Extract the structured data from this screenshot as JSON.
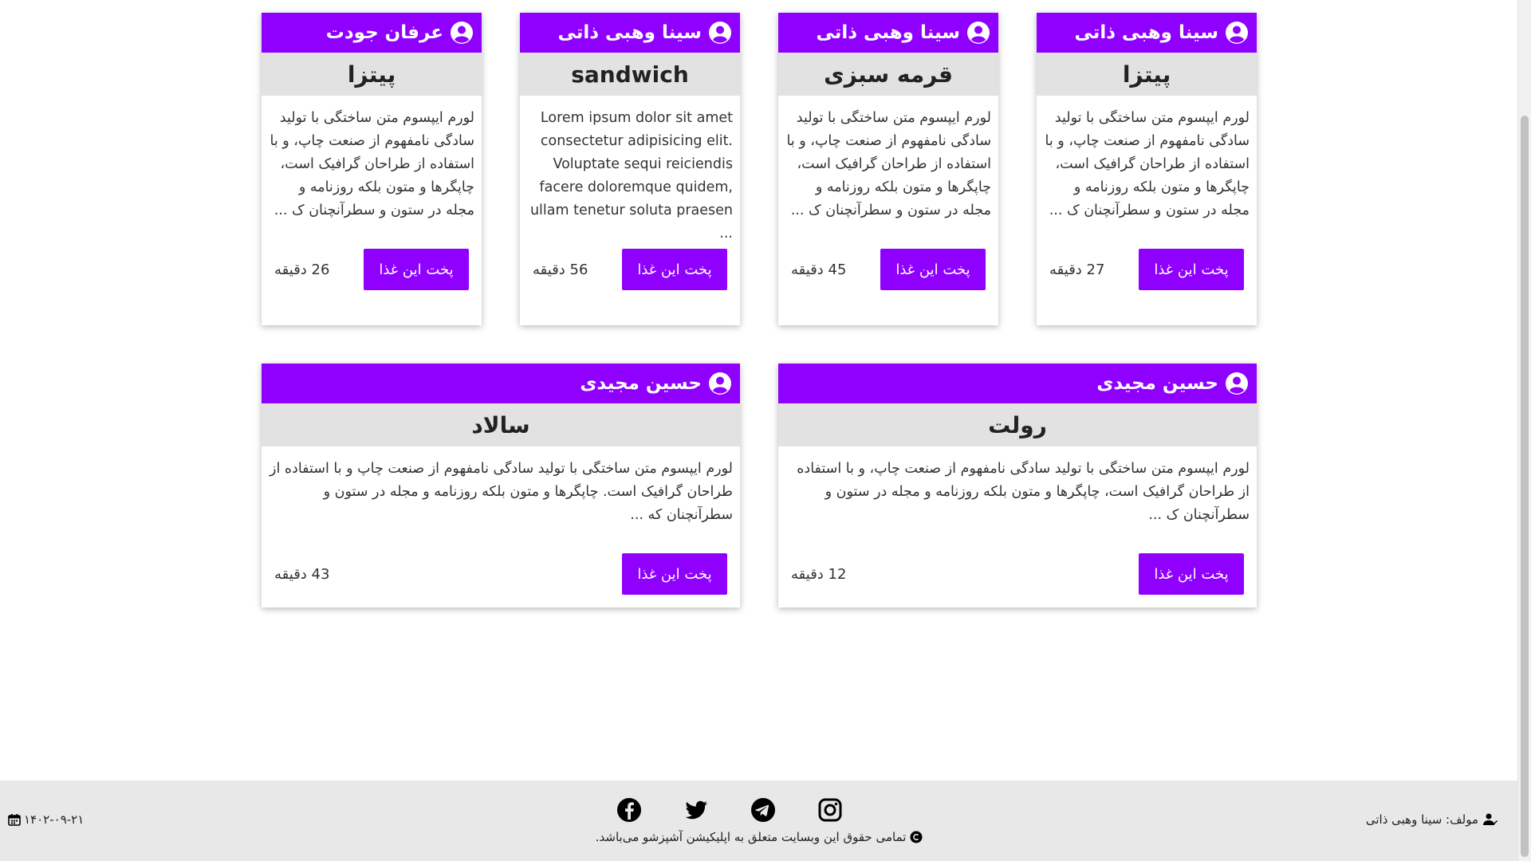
{
  "cards_top": [
    {
      "author": "سینا وهبی ذاتی",
      "title": "پیتزا",
      "desc": "لورم ایپسوم متن ساختگی با تولید سادگی نامفهوم از صنعت چاپ، و با استفاده از طراحان گرافیک است، چاپگرها و متون بلکه روزنامه و مجله در ستون و سطرآنچنان ک ...",
      "button": "پخت این غذا",
      "time": "27 دقیقه"
    },
    {
      "author": "سینا وهبی ذاتی",
      "title": "قرمه سبزی",
      "desc": "لورم ایپسوم متن ساختگی با تولید سادگی نامفهوم از صنعت چاپ، و با استفاده از طراحان گرافیک است، چاپگرها و متون بلکه روزنامه و مجله در ستون و سطرآنچنان ک ...",
      "button": "پخت این غذا",
      "time": "45 دقیقه"
    },
    {
      "author": "سینا وهبی ذاتی",
      "title": "sandwich",
      "desc": "Lorem ipsum dolor sit amet consectetur adipisicing elit. Voluptate sequi reiciendis facere doloremque quidem, ullam tenetur soluta praesen ...",
      "button": "پخت این غذا",
      "time": "56 دقیقه"
    },
    {
      "author": "عرفان جودت",
      "title": "پیتزا",
      "desc": "لورم ایپسوم متن ساختگی با تولید سادگی نامفهوم از صنعت چاپ، و با استفاده از طراحان گرافیک است، چاپگرها و متون بلکه روزنامه و مجله در ستون و سطرآنچنان ک ...",
      "button": "پخت این غذا",
      "time": "26 دقیقه"
    }
  ],
  "cards_bottom": [
    {
      "author": "حسین مجیدی",
      "title": "رولت",
      "desc": "لورم ایپسوم متن ساختگی با تولید سادگی نامفهوم از صنعت چاپ، و با استفاده از طراحان گرافیک است، چاپگرها و متون بلکه روزنامه و مجله در ستون و سطرآنچنان ک ...",
      "button": "پخت این غذا",
      "time": "12 دقیقه"
    },
    {
      "author": "حسین مجیدی",
      "title": "سالاد",
      "desc": "لورم ایپسوم متن ساختگی با تولید سادگی نامفهوم از صنعت چاپ و با استفاده از طراحان گرافیک است. چاپگرها و متون بلکه روزنامه و مجله در ستون و سطرآنچنان که ...",
      "button": "پخت این غذا",
      "time": "43 دقیقه"
    }
  ],
  "footer": {
    "copyright": "تمامی حقوق این وبسایت متعلق به اپلیکیشن آشپزشو می‌باشد.",
    "author_label": "مولف: سینا وهبی ذاتی",
    "date": "۱۴۰۲-۰۹-۲۱",
    "socials": [
      "instagram-icon",
      "telegram-icon",
      "twitter-icon",
      "facebook-icon"
    ]
  },
  "colors": {
    "accent": "#8f00ff",
    "title_bg": "#e2e2e2",
    "footer_bg": "#e8e8e8"
  }
}
